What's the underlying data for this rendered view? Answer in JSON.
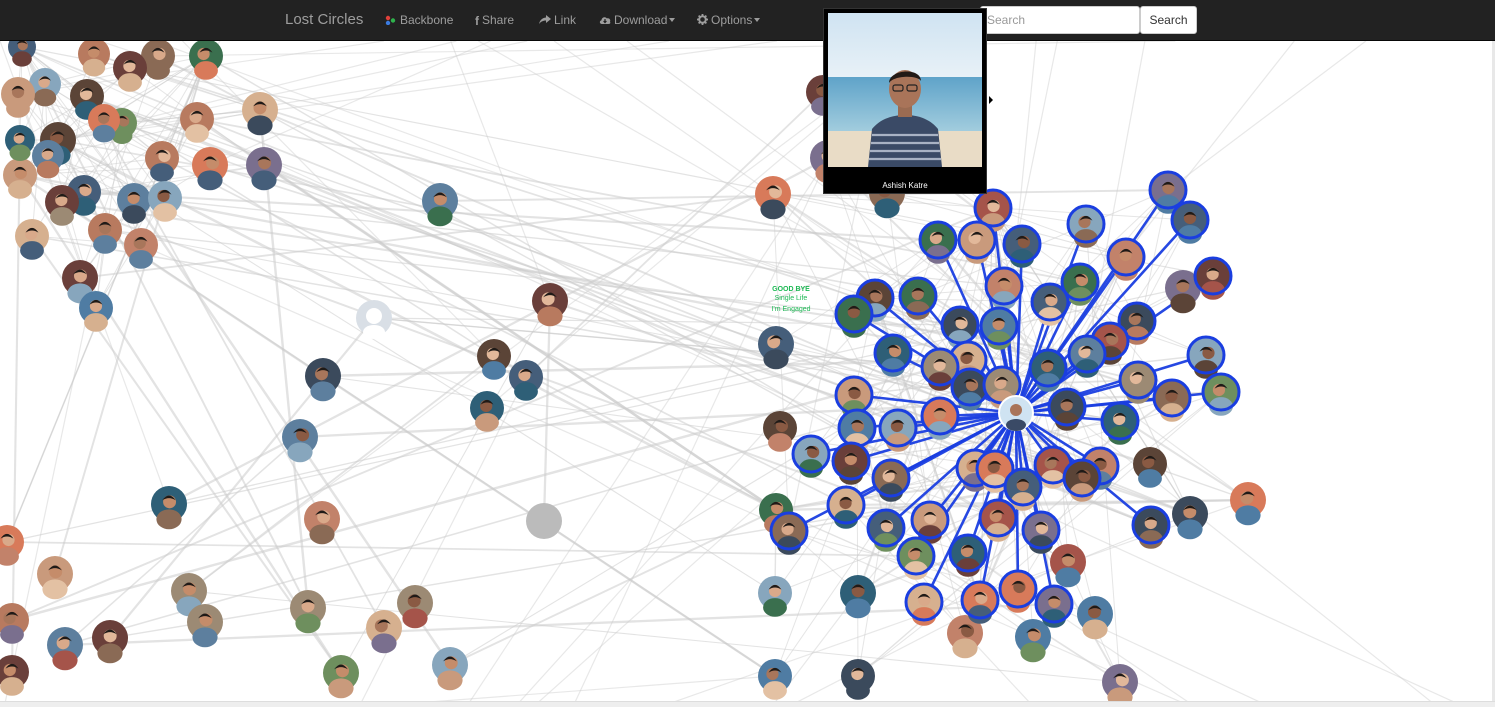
{
  "navbar": {
    "brand": "Lost Circles",
    "items": [
      {
        "label": "Backbone",
        "icon": "backbone-dots-icon"
      },
      {
        "label": "Share",
        "icon": "facebook-icon"
      },
      {
        "label": "Link",
        "icon": "share-arrow-icon"
      },
      {
        "label": "Download",
        "icon": "cloud-download-icon",
        "dropdown": true
      },
      {
        "label": "Options",
        "icon": "gear-icon",
        "dropdown": true
      }
    ],
    "search_placeholder": "Search",
    "search_button": "Search"
  },
  "tooltip": {
    "name": "Ashish Katre"
  },
  "graph": {
    "highlight_color": "#1a3ee0",
    "edge_color": "#cccccc",
    "node_count": 118
  },
  "graph_badge": {
    "lines": [
      "GOOD BYE",
      "Single Life",
      "I'm Engaged"
    ]
  }
}
